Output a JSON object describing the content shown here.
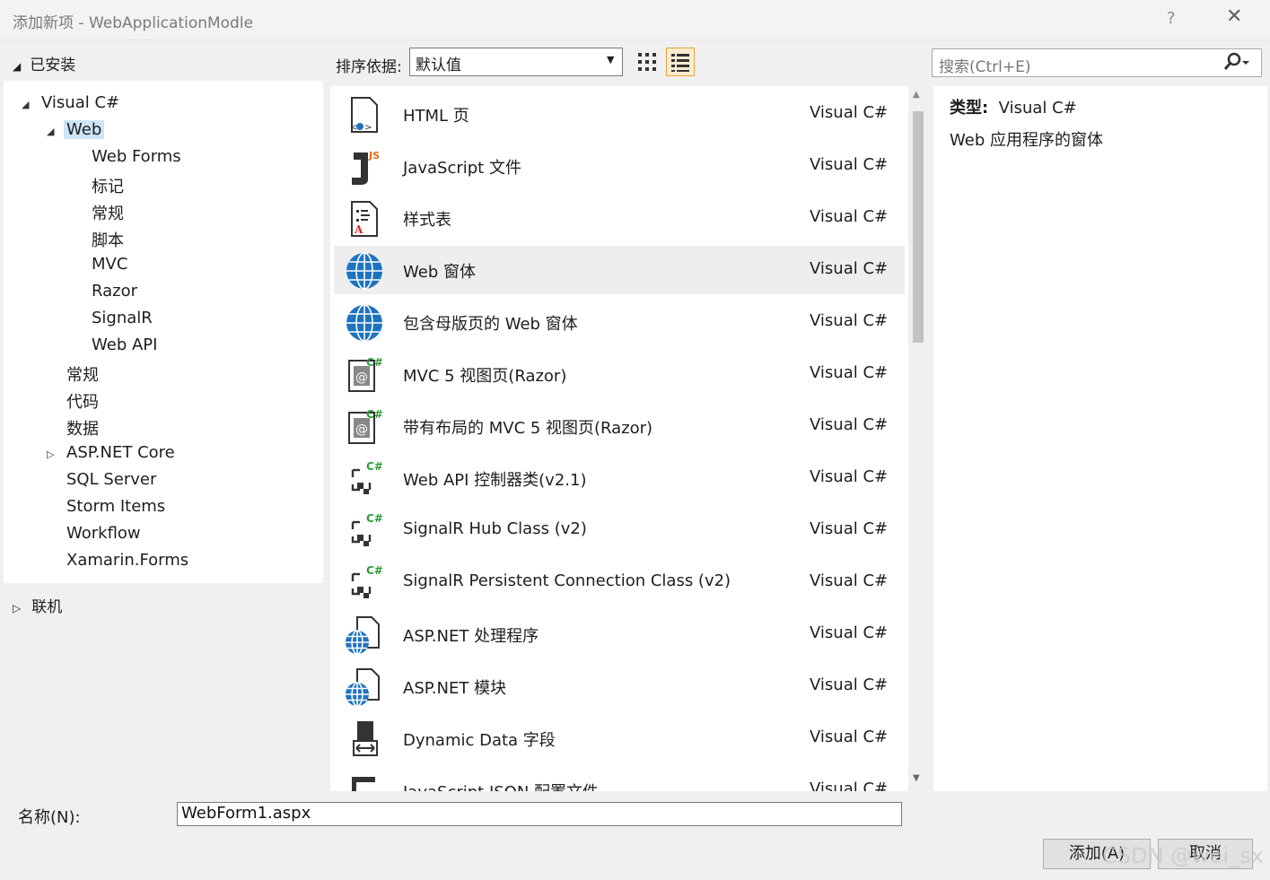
{
  "window": {
    "title": "添加新项 - WebApplicationModle",
    "help": "?",
    "close": "✕"
  },
  "left": {
    "installed": "已安装",
    "tree": [
      {
        "label": "Visual C#",
        "level": 0,
        "expanded": true
      },
      {
        "label": "Web",
        "level": 1,
        "expanded": true,
        "selected": true
      },
      {
        "label": "Web Forms",
        "level": 2
      },
      {
        "label": "标记",
        "level": 2
      },
      {
        "label": "常规",
        "level": 2
      },
      {
        "label": "脚本",
        "level": 2
      },
      {
        "label": "MVC",
        "level": 2
      },
      {
        "label": "Razor",
        "level": 2
      },
      {
        "label": "SignalR",
        "level": 2
      },
      {
        "label": "Web API",
        "level": 2
      },
      {
        "label": "常规",
        "level": 1
      },
      {
        "label": "代码",
        "level": 1
      },
      {
        "label": "数据",
        "level": 1
      },
      {
        "label": "ASP.NET Core",
        "level": 1,
        "collapsed": true
      },
      {
        "label": "SQL Server",
        "level": 1
      },
      {
        "label": "Storm Items",
        "level": 1
      },
      {
        "label": "Workflow",
        "level": 1
      },
      {
        "label": "Xamarin.Forms",
        "level": 1
      }
    ],
    "online": "联机"
  },
  "toolbar": {
    "sort_label": "排序依据:",
    "sort_value": "默认值",
    "search_placeholder": "搜索(Ctrl+E)"
  },
  "templates": [
    {
      "name": "HTML 页",
      "lang": "Visual C#",
      "icon": "html-page-icon"
    },
    {
      "name": "JavaScript 文件",
      "lang": "Visual C#",
      "icon": "javascript-file-icon"
    },
    {
      "name": "样式表",
      "lang": "Visual C#",
      "icon": "stylesheet-icon"
    },
    {
      "name": "Web 窗体",
      "lang": "Visual C#",
      "icon": "web-form-icon",
      "selected": true
    },
    {
      "name": "包含母版页的 Web 窗体",
      "lang": "Visual C#",
      "icon": "web-form-icon"
    },
    {
      "name": "MVC 5 视图页(Razor)",
      "lang": "Visual C#",
      "icon": "razor-view-icon"
    },
    {
      "name": "带有布局的 MVC 5 视图页(Razor)",
      "lang": "Visual C#",
      "icon": "razor-view-icon"
    },
    {
      "name": "Web API 控制器类(v2.1)",
      "lang": "Visual C#",
      "icon": "csharp-class-icon"
    },
    {
      "name": "SignalR Hub Class (v2)",
      "lang": "Visual C#",
      "icon": "csharp-class-icon"
    },
    {
      "name": "SignalR Persistent Connection Class (v2)",
      "lang": "Visual C#",
      "icon": "csharp-class-icon"
    },
    {
      "name": "ASP.NET 处理程序",
      "lang": "Visual C#",
      "icon": "aspnet-handler-icon"
    },
    {
      "name": "ASP.NET 模块",
      "lang": "Visual C#",
      "icon": "aspnet-handler-icon"
    },
    {
      "name": "Dynamic Data 字段",
      "lang": "Visual C#",
      "icon": "dynamic-data-icon"
    },
    {
      "name": "JavaScript JSON 配置文件",
      "lang": "Visual C#",
      "icon": "json-file-icon"
    }
  ],
  "details": {
    "type_label": "类型:",
    "type_value": "Visual C#",
    "description": "Web 应用程序的窗体"
  },
  "bottom": {
    "name_label": "名称(N):",
    "name_value": "WebForm1.aspx",
    "add_button": "添加(A)",
    "cancel_button": "取消"
  },
  "watermark": "CSDN @wei_sx",
  "colors": {
    "accent_blue": "#1e73be",
    "selected_tree": "#cce4f7",
    "list_selected": "#eeeeef",
    "view_toggle": "#fbeccf"
  }
}
